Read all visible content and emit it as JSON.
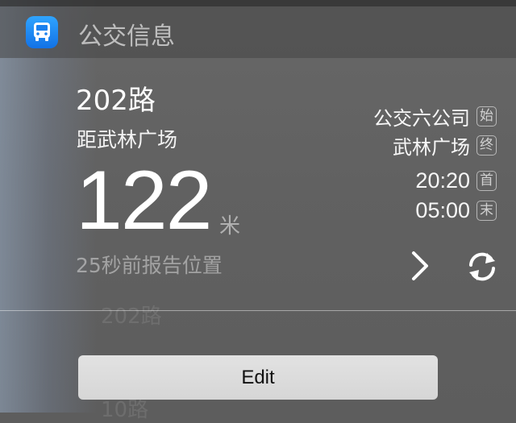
{
  "header": {
    "title": "公交信息",
    "app_icon": "bus-icon"
  },
  "route": {
    "name": "202路",
    "distance_label": "距武林广场",
    "distance_value": "122",
    "distance_unit": "米",
    "report_time": "25秒前报告位置"
  },
  "info": {
    "start_station": "公交六公司",
    "start_badge": "始",
    "end_station": "武林广场",
    "end_badge": "终",
    "first_bus": "20:20",
    "first_badge": "首",
    "last_bus": "05:00",
    "last_badge": "末"
  },
  "actions": {
    "detail_icon": "chevron-right-icon",
    "refresh_icon": "refresh-icon"
  },
  "edit_label": "Edit",
  "colors": {
    "app_icon": "#1e8cf5",
    "text": "#ffffff"
  }
}
